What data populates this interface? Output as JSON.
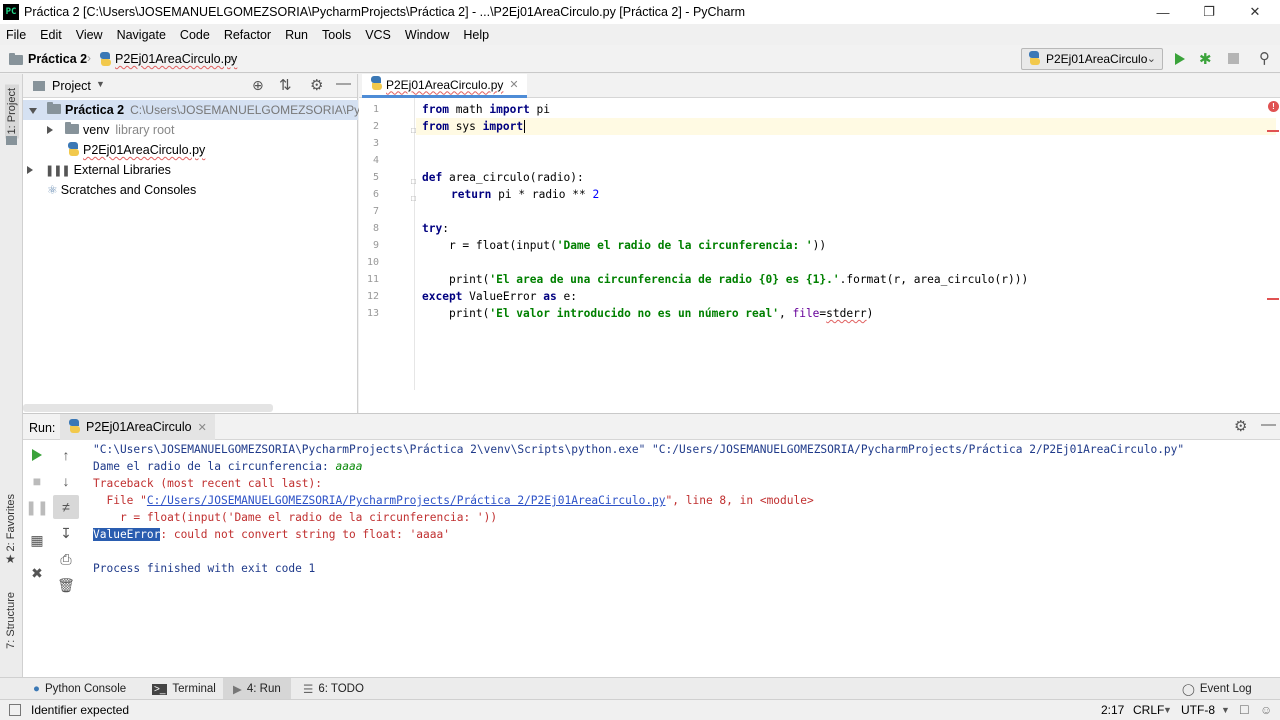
{
  "window": {
    "title": "Práctica 2 [C:\\Users\\JOSEMANUELGOMEZSORIA\\PycharmProjects\\Práctica 2] - ...\\P2Ej01AreaCirculo.py [Práctica 2] - PyCharm",
    "app_icon": "PC"
  },
  "menu": [
    "File",
    "Edit",
    "View",
    "Navigate",
    "Code",
    "Refactor",
    "Run",
    "Tools",
    "VCS",
    "Window",
    "Help"
  ],
  "breadcrumb": {
    "project": "Práctica 2",
    "file": "P2Ej01AreaCirculo.py"
  },
  "run_config": {
    "selected": "P2Ej01AreaCirculo"
  },
  "left_stripe": {
    "project_tab": "1: Project",
    "favorites_tab": "2: Favorites",
    "structure_tab": "7: Structure"
  },
  "project_panel": {
    "title": "Project",
    "tree": {
      "root_name": "Práctica 2",
      "root_path": "C:\\Users\\JOSEMANUELGOMEZSORIA\\Pycha",
      "venv": "venv",
      "venv_hint": "library root",
      "file": "P2Ej01AreaCirculo.py",
      "external": "External Libraries",
      "scratches": "Scratches and Consoles"
    }
  },
  "editor": {
    "tab_label": "P2Ej01AreaCirculo.py",
    "line_numbers": [
      "1",
      "2",
      "3",
      "4",
      "5",
      "6",
      "7",
      "8",
      "9",
      "10",
      "11",
      "12",
      "13"
    ],
    "code": {
      "l1_kw1": "from",
      "l1_a": " math ",
      "l1_kw2": "import",
      "l1_b": " pi",
      "l2_kw1": "from",
      "l2_a": " sys ",
      "l2_kw2": "import",
      "l5_kw": "def",
      "l5_a": " area_circulo(",
      "l5_p": "radio",
      "l5_b": "):",
      "l6_kw": "return",
      "l6_a": " pi * ",
      "l6_p": "radio",
      "l6_b": " ** ",
      "l6_n": "2",
      "l8_kw": "try",
      "l8_b": ":",
      "l9_a": "    r = float(input(",
      "l9_s": "'Dame el radio de la circunferencia: '",
      "l9_b": "))",
      "l11_a": "    print(",
      "l11_s": "'El area de una circunferencia de radio {0} es {1}.'",
      "l11_b": ".format(r, area_circulo(r)))",
      "l12_kw": "except",
      "l12_a": " ValueError ",
      "l12_kw2": "as",
      "l12_b": " e:",
      "l13_a": "    print(",
      "l13_s": "'El valor introducido no es un número real'",
      "l13_b": ", ",
      "l13_p": "file",
      "l13_c": "=",
      "l13_d": "stderr",
      "l13_e": ")"
    }
  },
  "run_panel": {
    "label": "Run:",
    "tab": "P2Ej01AreaCirculo",
    "output": {
      "cmd": "\"C:\\Users\\JOSEMANUELGOMEZSORIA\\PycharmProjects\\Práctica 2\\venv\\Scripts\\python.exe\" \"C:/Users/JOSEMANUELGOMEZSORIA/PycharmProjects/Práctica 2/P2Ej01AreaCirculo.py\"",
      "prompt": "Dame el radio de la circunferencia: ",
      "input": "aaaa",
      "tb": "Traceback (most recent call last):",
      "file_pre": "  File \"",
      "file_link": "C:/Users/JOSEMANUELGOMEZSORIA/PycharmProjects/Práctica 2/P2Ej01AreaCirculo.py",
      "file_post": "\", line 8, in <module>",
      "code_line": "    r = float(input('Dame el radio de la circunferencia: '))",
      "err_name": "ValueError",
      "err_msg": ": could not convert string to float: 'aaaa'",
      "finished": "Process finished with exit code 1"
    }
  },
  "bottom_tabs": [
    "Python Console",
    "Terminal",
    "4: Run",
    "6: TODO",
    "Event Log"
  ],
  "status": {
    "message": "Identifier expected",
    "position": "2:17",
    "line_sep": "CRLF",
    "encoding": "UTF-8"
  }
}
